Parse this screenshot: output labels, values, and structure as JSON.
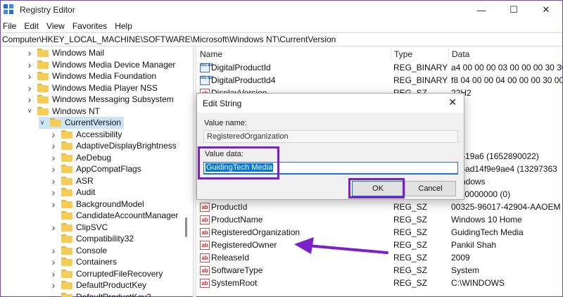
{
  "window": {
    "title": "Registry Editor",
    "controls": {
      "minimize": "—",
      "maximize": "☐",
      "close": "✕"
    }
  },
  "menu": [
    "File",
    "Edit",
    "View",
    "Favorites",
    "Help"
  ],
  "address": "Computer\\HKEY_LOCAL_MACHINE\\SOFTWARE\\Microsoft\\Windows NT\\CurrentVersion",
  "tree": {
    "items": [
      {
        "label": "Windows Mail",
        "level": 1,
        "expanded": false
      },
      {
        "label": "Windows Media Device Manager",
        "level": 1,
        "expanded": false
      },
      {
        "label": "Windows Media Foundation",
        "level": 1,
        "expanded": false
      },
      {
        "label": "Windows Media Player NSS",
        "level": 1,
        "expanded": false
      },
      {
        "label": "Windows Messaging Subsystem",
        "level": 1,
        "expanded": false
      },
      {
        "label": "Windows NT",
        "level": 1,
        "expanded": true
      },
      {
        "label": "CurrentVersion",
        "level": 2,
        "expanded": true,
        "selected": true
      },
      {
        "label": "Accessibility",
        "level": 3,
        "expanded": false
      },
      {
        "label": "AdaptiveDisplayBrightness",
        "level": 3,
        "expanded": false
      },
      {
        "label": "AeDebug",
        "level": 3,
        "expanded": false
      },
      {
        "label": "AppCompatFlags",
        "level": 3,
        "expanded": false
      },
      {
        "label": "ASR",
        "level": 3,
        "expanded": false
      },
      {
        "label": "Audit",
        "level": 3,
        "expanded": false
      },
      {
        "label": "BackgroundModel",
        "level": 3,
        "expanded": false
      },
      {
        "label": "CandidateAccountManager",
        "level": 3,
        "expanded": null
      },
      {
        "label": "ClipSVC",
        "level": 3,
        "expanded": false
      },
      {
        "label": "Compatibility32",
        "level": 3,
        "expanded": null
      },
      {
        "label": "Console",
        "level": 3,
        "expanded": false
      },
      {
        "label": "Containers",
        "level": 3,
        "expanded": false
      },
      {
        "label": "CorruptedFileRecovery",
        "level": 3,
        "expanded": false
      },
      {
        "label": "DefaultProductKey",
        "level": 3,
        "expanded": false
      },
      {
        "label": "DefaultProductKey2",
        "level": 3,
        "expanded": false
      }
    ]
  },
  "list": {
    "headers": {
      "name": "Name",
      "type": "Type",
      "data": "Data"
    },
    "rows": [
      {
        "name": "DigitalProductId",
        "type": "REG_BINARY",
        "data": "a4 00 00 00 03 00 00 00 30 30 33",
        "icon": "binary-value-icon"
      },
      {
        "name": "DigitalProductId4",
        "type": "REG_BINARY",
        "data": "f8 04 00 00 04 00 00 00 30 00 33",
        "icon": "binary-value-icon"
      },
      {
        "name": "DisplayVersion",
        "type": "REG_SZ",
        "data": "22H2",
        "icon": "string-value-icon"
      },
      {
        "name": "",
        "type": "",
        "data": "e",
        "icon": ""
      },
      {
        "name": "",
        "type": "",
        "data": "",
        "icon": ""
      },
      {
        "name": "",
        "type": "",
        "data": "",
        "icon": ""
      },
      {
        "name": "",
        "type": "",
        "data": "ent",
        "icon": ""
      },
      {
        "name": "",
        "type": "",
        "data": "28519a6 (1652890022)",
        "icon": ""
      },
      {
        "name": "",
        "type": "",
        "data": "d86ad14f9e9ae4 (13297363",
        "icon": ""
      },
      {
        "name": "",
        "type": "",
        "data": "Windows",
        "icon": ""
      },
      {
        "name": "PendingInstall",
        "type": "REG_DWORD",
        "data": "0x00000000 (0)",
        "icon": "binary-value-icon"
      },
      {
        "name": "ProductId",
        "type": "REG_SZ",
        "data": "00325-96017-42904-AAOEM",
        "icon": "string-value-icon"
      },
      {
        "name": "ProductName",
        "type": "REG_SZ",
        "data": "Windows 10 Home",
        "icon": "string-value-icon"
      },
      {
        "name": "RegisteredOrganization",
        "type": "REG_SZ",
        "data": "GuidingTech Media",
        "icon": "string-value-icon",
        "highlighted": true
      },
      {
        "name": "RegisteredOwner",
        "type": "REG_SZ",
        "data": "Pankil Shah",
        "icon": "string-value-icon"
      },
      {
        "name": "ReleaseId",
        "type": "REG_SZ",
        "data": "2009",
        "icon": "string-value-icon"
      },
      {
        "name": "SoftwareType",
        "type": "REG_SZ",
        "data": "System",
        "icon": "string-value-icon"
      },
      {
        "name": "SystemRoot",
        "type": "REG_SZ",
        "data": "C:\\WINDOWS",
        "icon": "string-value-icon"
      }
    ]
  },
  "dialog": {
    "title": "Edit String",
    "close": "✕",
    "value_name_label": "Value name:",
    "value_name": "RegisteredOrganization",
    "value_data_label": "Value data:",
    "value_data": "GuidingTech Media",
    "ok_label": "OK",
    "cancel_label": "Cancel"
  },
  "colors": {
    "annotation": "#7a20c9",
    "selection": "#0078d7",
    "tree_selected": "#cce4f7"
  }
}
